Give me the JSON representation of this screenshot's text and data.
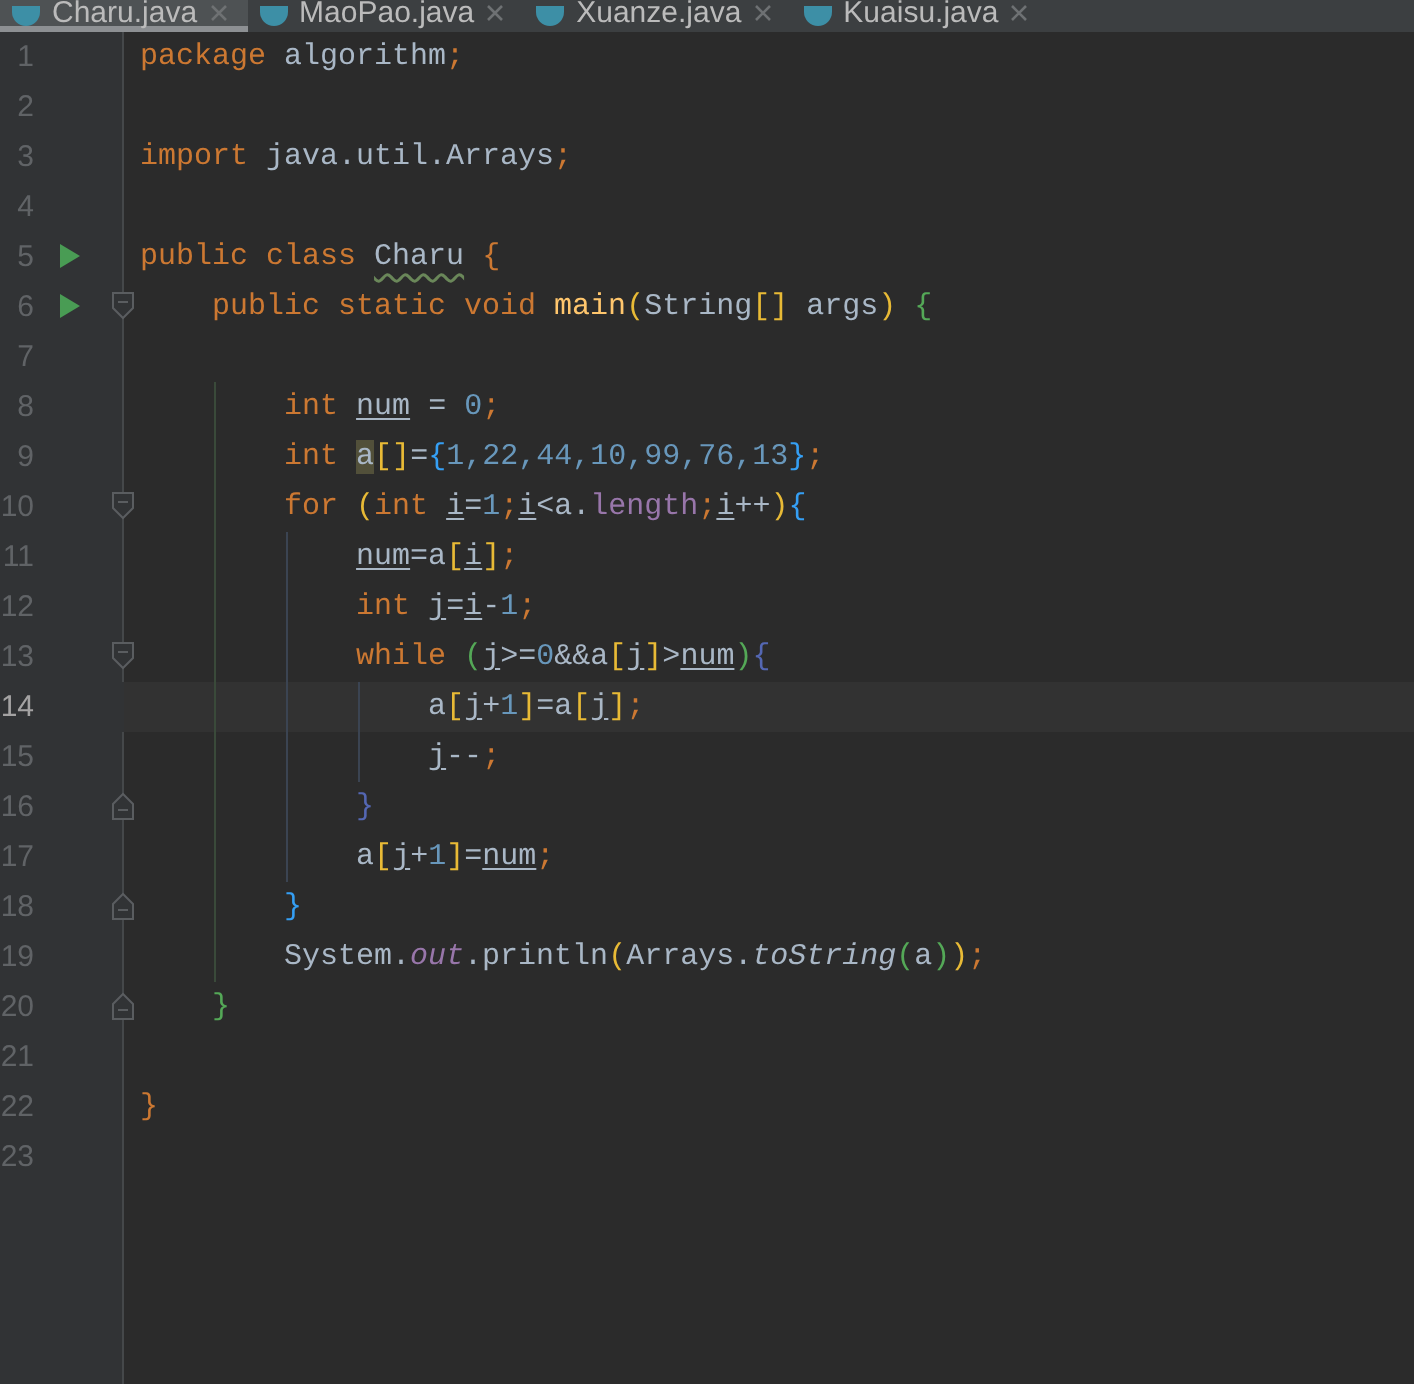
{
  "tabs": [
    {
      "label": "Charu.java",
      "selected": true
    },
    {
      "label": "MaoPao.java",
      "selected": false
    },
    {
      "label": "Xuanze.java",
      "selected": false
    },
    {
      "label": "Kuaisu.java",
      "selected": false
    }
  ],
  "lines": [
    {
      "number": "1",
      "current": false,
      "run": false,
      "fold_open": false,
      "fold_close": false,
      "tokens": [
        {
          "kind": "kw",
          "text": "package "
        },
        {
          "kind": "plain",
          "text": "algorithm"
        },
        {
          "kind": "punct",
          "text": ";"
        }
      ]
    },
    {
      "number": "2",
      "current": false,
      "run": false,
      "fold_open": false,
      "fold_close": false
    },
    {
      "number": "3",
      "current": false,
      "run": false,
      "fold_open": false,
      "fold_close": false,
      "tokens": [
        {
          "kind": "kw",
          "text": "import "
        },
        {
          "kind": "plain",
          "text": "java.util.Arrays"
        },
        {
          "kind": "punct",
          "text": ";"
        }
      ]
    },
    {
      "number": "4",
      "current": false,
      "run": false,
      "fold_open": false,
      "fold_close": false
    },
    {
      "number": "5",
      "current": false,
      "run": true,
      "fold_open": false,
      "fold_close": false,
      "tokens": [
        {
          "kind": "kw",
          "text": "public class "
        },
        {
          "kind": "wavy",
          "text": "Charu"
        },
        {
          "kind": "punct",
          "text": " {"
        }
      ]
    },
    {
      "number": "6",
      "current": false,
      "run": true,
      "fold_open": true,
      "fold_close": false,
      "tokens": [
        {
          "kind": "kw",
          "text": "    public static void "
        },
        {
          "kind": "fn",
          "text": "main"
        },
        {
          "kind": "b1",
          "text": "("
        },
        {
          "kind": "plain",
          "text": "String"
        },
        {
          "kind": "b1",
          "text": "[]"
        },
        {
          "kind": "plain",
          "text": " args"
        },
        {
          "kind": "b1",
          "text": ")"
        },
        {
          "kind": "b3",
          "text": " {"
        }
      ]
    },
    {
      "number": "7",
      "current": false,
      "run": false,
      "fold_open": false,
      "fold_close": false
    },
    {
      "number": "8",
      "current": false,
      "run": false,
      "fold_open": false,
      "fold_close": false,
      "tokens": [
        {
          "kind": "kw",
          "text": "        int "
        },
        {
          "kind": "var",
          "text": "num"
        },
        {
          "kind": "plain",
          "text": " = "
        },
        {
          "kind": "num",
          "text": "0"
        },
        {
          "kind": "punct",
          "text": ";"
        }
      ]
    },
    {
      "number": "9",
      "current": false,
      "run": false,
      "fold_open": false,
      "fold_close": false,
      "tokens": [
        {
          "kind": "kw",
          "text": "        int "
        },
        {
          "kind": "caret",
          "text": "a"
        },
        {
          "kind": "b1",
          "text": "[]"
        },
        {
          "kind": "plain",
          "text": "="
        },
        {
          "kind": "b4",
          "text": "{"
        },
        {
          "kind": "num",
          "text": "1,22,44,10,99,76,13"
        },
        {
          "kind": "b4",
          "text": "}"
        },
        {
          "kind": "punct",
          "text": ";"
        }
      ]
    },
    {
      "number": "10",
      "current": false,
      "run": false,
      "fold_open": true,
      "fold_close": false,
      "tokens": [
        {
          "kind": "kw",
          "text": "        for "
        },
        {
          "kind": "b1",
          "text": "("
        },
        {
          "kind": "kw",
          "text": "int "
        },
        {
          "kind": "var",
          "text": "i"
        },
        {
          "kind": "plain",
          "text": "="
        },
        {
          "kind": "num",
          "text": "1"
        },
        {
          "kind": "punct",
          "text": ";"
        },
        {
          "kind": "var",
          "text": "i"
        },
        {
          "kind": "plain",
          "text": "<a."
        },
        {
          "kind": "field",
          "text": "length"
        },
        {
          "kind": "punct",
          "text": ";"
        },
        {
          "kind": "var",
          "text": "i"
        },
        {
          "kind": "plain",
          "text": "++"
        },
        {
          "kind": "b1",
          "text": ")"
        },
        {
          "kind": "b4",
          "text": "{"
        }
      ]
    },
    {
      "number": "11",
      "current": false,
      "run": false,
      "fold_open": false,
      "fold_close": false,
      "tokens": [
        {
          "kind": "var",
          "text": "            num"
        },
        {
          "kind": "plain",
          "text": "=a"
        },
        {
          "kind": "b1",
          "text": "["
        },
        {
          "kind": "var",
          "text": "i"
        },
        {
          "kind": "b1",
          "text": "]"
        },
        {
          "kind": "punct",
          "text": ";"
        }
      ]
    },
    {
      "number": "12",
      "current": false,
      "run": false,
      "fold_open": false,
      "fold_close": false,
      "tokens": [
        {
          "kind": "kw",
          "text": "            int "
        },
        {
          "kind": "var",
          "text": "j"
        },
        {
          "kind": "plain",
          "text": "="
        },
        {
          "kind": "var",
          "text": "i"
        },
        {
          "kind": "plain",
          "text": "-"
        },
        {
          "kind": "num",
          "text": "1"
        },
        {
          "kind": "punct",
          "text": ";"
        }
      ]
    },
    {
      "number": "13",
      "current": false,
      "run": false,
      "fold_open": true,
      "fold_close": false,
      "tokens": [
        {
          "kind": "kw",
          "text": "            while "
        },
        {
          "kind": "b3",
          "text": "("
        },
        {
          "kind": "var",
          "text": "j"
        },
        {
          "kind": "plain",
          "text": ">="
        },
        {
          "kind": "num",
          "text": "0"
        },
        {
          "kind": "plain",
          "text": "&&a"
        },
        {
          "kind": "b1",
          "text": "["
        },
        {
          "kind": "var",
          "text": "j"
        },
        {
          "kind": "b1",
          "text": "]"
        },
        {
          "kind": "plain",
          "text": ">"
        },
        {
          "kind": "var",
          "text": "num"
        },
        {
          "kind": "b3",
          "text": ")"
        },
        {
          "kind": "b5",
          "text": "{"
        }
      ]
    },
    {
      "number": "14",
      "current": true,
      "run": false,
      "fold_open": false,
      "fold_close": false,
      "tokens": [
        {
          "kind": "plain",
          "text": "                a"
        },
        {
          "kind": "b1",
          "text": "["
        },
        {
          "kind": "var",
          "text": "j"
        },
        {
          "kind": "plain",
          "text": "+"
        },
        {
          "kind": "num",
          "text": "1"
        },
        {
          "kind": "b1",
          "text": "]"
        },
        {
          "kind": "plain",
          "text": "=a"
        },
        {
          "kind": "b1",
          "text": "["
        },
        {
          "kind": "var",
          "text": "j"
        },
        {
          "kind": "b1",
          "text": "]"
        },
        {
          "kind": "punct",
          "text": ";"
        }
      ]
    },
    {
      "number": "15",
      "current": false,
      "run": false,
      "fold_open": false,
      "fold_close": false,
      "tokens": [
        {
          "kind": "var",
          "text": "                j"
        },
        {
          "kind": "plain",
          "text": "--"
        },
        {
          "kind": "punct",
          "text": ";"
        }
      ]
    },
    {
      "number": "16",
      "current": false,
      "run": false,
      "fold_open": false,
      "fold_close": true,
      "tokens": [
        {
          "kind": "b5",
          "text": "            }"
        }
      ]
    },
    {
      "number": "17",
      "current": false,
      "run": false,
      "fold_open": false,
      "fold_close": false,
      "tokens": [
        {
          "kind": "plain",
          "text": "            a"
        },
        {
          "kind": "b1",
          "text": "["
        },
        {
          "kind": "var",
          "text": "j"
        },
        {
          "kind": "plain",
          "text": "+"
        },
        {
          "kind": "num",
          "text": "1"
        },
        {
          "kind": "b1",
          "text": "]"
        },
        {
          "kind": "plain",
          "text": "="
        },
        {
          "kind": "var",
          "text": "num"
        },
        {
          "kind": "punct",
          "text": ";"
        }
      ]
    },
    {
      "number": "18",
      "current": false,
      "run": false,
      "fold_open": false,
      "fold_close": true,
      "tokens": [
        {
          "kind": "b4",
          "text": "        }"
        }
      ]
    },
    {
      "number": "19",
      "current": false,
      "run": false,
      "fold_open": false,
      "fold_close": false,
      "tokens": [
        {
          "kind": "plain",
          "text": "        System."
        },
        {
          "kind": "sfield",
          "text": "out"
        },
        {
          "kind": "plain",
          "text": ".println"
        },
        {
          "kind": "b1",
          "text": "("
        },
        {
          "kind": "plain",
          "text": "Arrays."
        },
        {
          "kind": "static",
          "text": "toString"
        },
        {
          "kind": "b3",
          "text": "("
        },
        {
          "kind": "plain",
          "text": "a"
        },
        {
          "kind": "b3",
          "text": ")"
        },
        {
          "kind": "b1",
          "text": ")"
        },
        {
          "kind": "punct",
          "text": ";"
        }
      ]
    },
    {
      "number": "20",
      "current": false,
      "run": false,
      "fold_open": false,
      "fold_close": true,
      "tokens": [
        {
          "kind": "b3",
          "text": "    }"
        }
      ]
    },
    {
      "number": "21",
      "current": false,
      "run": false,
      "fold_open": false,
      "fold_close": false
    },
    {
      "number": "22",
      "current": false,
      "run": false,
      "fold_open": false,
      "fold_close": false,
      "tokens": [
        {
          "kind": "punct",
          "text": "}"
        }
      ]
    },
    {
      "number": "23",
      "current": false,
      "run": false,
      "fold_open": false,
      "fold_close": false
    }
  ]
}
